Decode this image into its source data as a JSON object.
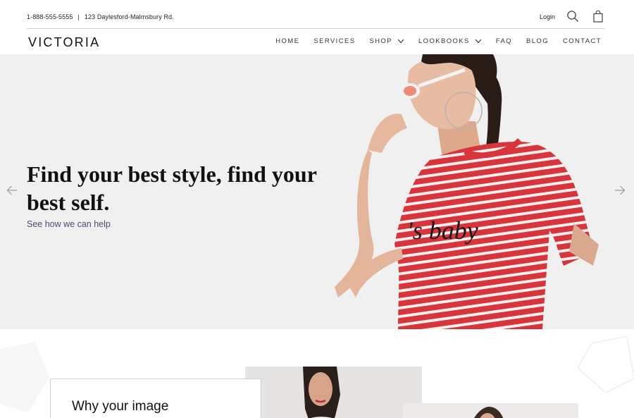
{
  "topbar": {
    "phone": "1-888-555-5555",
    "separator": "|",
    "address": "123 Daylesford-Malmsbury Rd.",
    "login_label": "Login",
    "search_icon": "search-icon",
    "cart_icon": "shopping-bag-icon"
  },
  "brand": {
    "logo_text": "VICTORIA"
  },
  "nav": {
    "items": [
      {
        "label": "HOME"
      },
      {
        "label": "SERVICES"
      },
      {
        "label": "SHOP",
        "dropdown": true
      },
      {
        "label": "LOOKBOOKS",
        "dropdown": true
      },
      {
        "label": "FAQ"
      },
      {
        "label": "BLOG"
      },
      {
        "label": "CONTACT"
      }
    ]
  },
  "hero": {
    "title": "Find your best style, find your best self.",
    "link_text": "See how we can help",
    "prev_icon": "arrow-left-icon",
    "next_icon": "arrow-right-icon"
  },
  "section": {
    "card_title": "Why your image"
  },
  "colors": {
    "link": "#4a4b78",
    "hero_bg": "#f1f0f0",
    "divider": "#cfcfcf",
    "shirt_red": "#d8343b"
  }
}
